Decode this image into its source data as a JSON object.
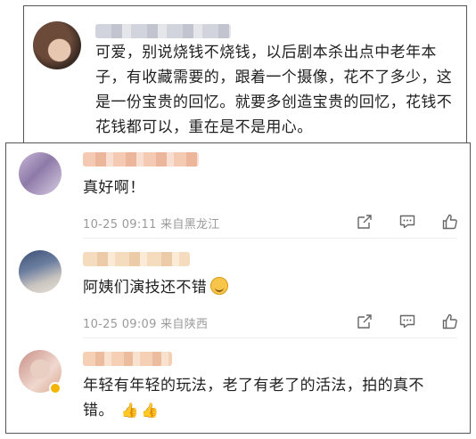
{
  "top_comment": {
    "text": "可爱，别说烧钱不烧钱，以后剧本杀出点中老年本子，有收藏需要的，跟着一个摄像，花不了多少，这是一份宝贵的回忆。就要多创造宝贵的回忆，花钱不花钱都可以，重在是不是用心。"
  },
  "comments": [
    {
      "text": "真好啊！",
      "time": "10-25 09:11",
      "location": "来自黑龙江"
    },
    {
      "text": "阿姨们演技还不错",
      "emoji": "smiling-face",
      "time": "10-25 09:09",
      "location": "来自陕西"
    },
    {
      "text": "年轻有年轻的玩法，老了有老了的活法，拍的真不错。",
      "emoji": "thumbs-up x2"
    }
  ],
  "icons": {
    "share": "share-icon",
    "comment": "comment-icon",
    "like": "like-icon"
  }
}
